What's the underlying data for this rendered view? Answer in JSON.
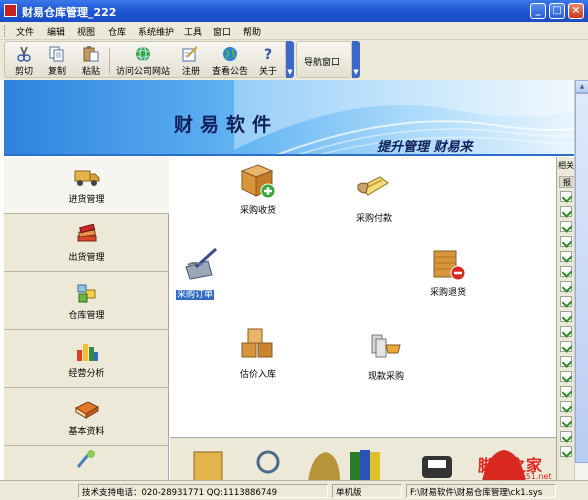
{
  "window": {
    "title": "财易仓库管理_222"
  },
  "menu": [
    "文件",
    "编辑",
    "视图",
    "仓库",
    "系统维护",
    "工具",
    "窗口",
    "帮助"
  ],
  "toolbar": {
    "group1": [
      {
        "label": "剪切",
        "icon": "scissors-icon"
      },
      {
        "label": "复制",
        "icon": "copy-icon"
      },
      {
        "label": "粘贴",
        "icon": "paste-icon"
      },
      {
        "label": "访问公司网站",
        "icon": "globe-icon"
      },
      {
        "label": "注册",
        "icon": "register-icon"
      },
      {
        "label": "查看公告",
        "icon": "earth-icon"
      },
      {
        "label": "关于",
        "icon": "help-icon"
      }
    ],
    "group2": [
      {
        "label": "导航窗口"
      }
    ]
  },
  "banner": {
    "title": "财易软件",
    "slogan": "提升管理 财易来"
  },
  "nav": [
    {
      "label": "进货管理",
      "icon": "truck-icon",
      "active": true
    },
    {
      "label": "出货管理",
      "icon": "books-icon"
    },
    {
      "label": "仓库管理",
      "icon": "warehouse-icon"
    },
    {
      "label": "经营分析",
      "icon": "bar-chart-icon"
    },
    {
      "label": "基本资料",
      "icon": "book-icon"
    }
  ],
  "content": {
    "items": [
      {
        "label": "采购收货",
        "icon": "box-add-icon"
      },
      {
        "label": "采购付款",
        "icon": "payment-icon"
      },
      {
        "label": "采购订单",
        "icon": "order-icon",
        "selected": true
      },
      {
        "label": "采购退货",
        "icon": "box-remove-icon"
      },
      {
        "label": "估价入库",
        "icon": "boxes-icon"
      },
      {
        "label": "现款采购",
        "icon": "cash-icon"
      }
    ]
  },
  "side_panel": {
    "title": "相关",
    "header": "报"
  },
  "status": {
    "support": "技术支持电话：020-28931771 QQ:1113886749",
    "mode": "单机版",
    "path": "F:\\财易软件\\财易仓库管理\\ck1.sys"
  },
  "watermark": {
    "text": "脚本之家",
    "url": "www.jb51.net"
  },
  "colors": {
    "titlebar": "#1f55d4",
    "banner": "#5fb2f2",
    "selection": "#316ac5"
  }
}
